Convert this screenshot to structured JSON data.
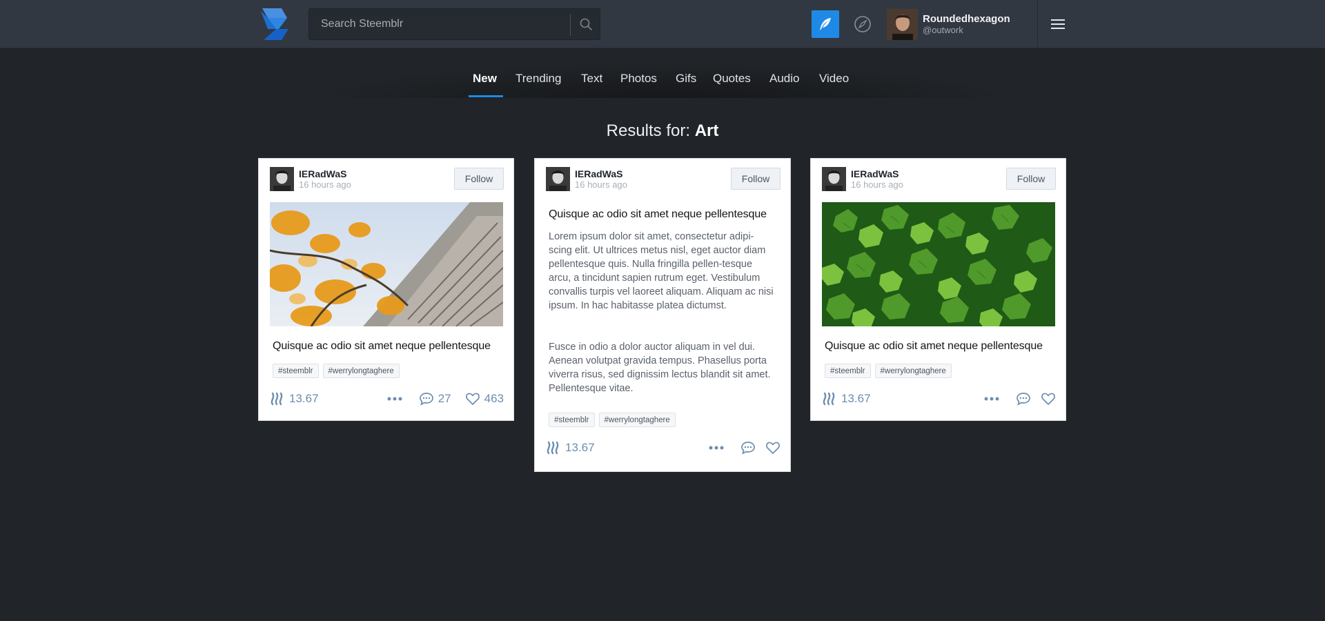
{
  "header": {
    "search_placeholder": "Search Steemblr",
    "user": {
      "name": "Roundedhexagon",
      "handle": "@outwork"
    },
    "accent_color": "#1f8ae6"
  },
  "tabs": [
    {
      "label": "New",
      "active": true
    },
    {
      "label": "Trending"
    },
    {
      "label": "Text"
    },
    {
      "label": "Photos"
    },
    {
      "label": "Gifs"
    },
    {
      "label": "Quotes"
    },
    {
      "label": "Audio"
    },
    {
      "label": "Video"
    }
  ],
  "results": {
    "prefix": "Results for:",
    "query": "Art"
  },
  "cards": [
    {
      "author": "IERadWaS",
      "time": "16 hours ago",
      "follow_label": "Follow",
      "image": "autumn-building-photo",
      "title": "Quisque ac odio sit amet neque pellentesque",
      "tags": [
        "#steemblr",
        "#werrylongtaghere"
      ],
      "payout": "13.67",
      "comments": "27",
      "likes": "463"
    },
    {
      "author": "IERadWaS",
      "time": "16 hours ago",
      "follow_label": "Follow",
      "title": "Quisque ac odio sit amet neque pellentesque",
      "paragraphs": [
        "Lorem ipsum dolor sit amet, consectetur adipi-scing elit. Ut ultrices metus nisl, eget auctor diam pellentesque quis. Nulla fringilla pellen-tesque arcu, a tincidunt sapien rutrum eget. Vestibulum convallis turpis vel laoreet aliquam. Aliquam ac nisi ipsum. In hac habitasse platea dictumst.",
        "Fusce in odio a dolor auctor aliquam in vel dui. Aenean volutpat gravida tempus. Phasellus porta viverra risus, sed dignissim lectus blandit sit amet. Pellentesque vitae."
      ],
      "tags": [
        "#steemblr",
        "#werrylongtaghere"
      ],
      "payout": "13.67"
    },
    {
      "author": "IERadWaS",
      "time": "16 hours ago",
      "follow_label": "Follow",
      "image": "green-ivy-leaves-photo",
      "title": "Quisque ac odio sit amet neque pellentesque",
      "tags": [
        "#steemblr",
        "#werrylongtaghere"
      ],
      "payout": "13.67"
    }
  ]
}
